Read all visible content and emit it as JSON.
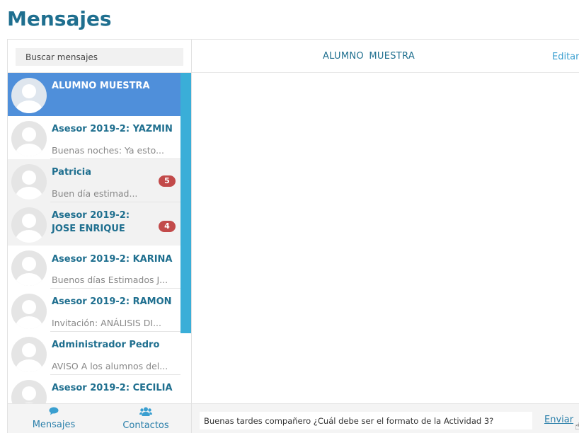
{
  "page": {
    "title": "Mensajes"
  },
  "search": {
    "placeholder": "Buscar mensajes"
  },
  "conversations": [
    {
      "name": "ALUMNO MUESTRA",
      "preview": "",
      "badge": "",
      "selected": true
    },
    {
      "name": "Asesor 2019-2: YAZMIN",
      "preview": "Buenas noches: Ya esto...",
      "badge": ""
    },
    {
      "name": "Patricia",
      "preview": "Buen día estimad...",
      "badge": "5"
    },
    {
      "name": "Asesor 2019-2: JOSE ENRIQUE",
      "preview": "",
      "badge": "4"
    },
    {
      "name": "Asesor 2019-2: KARINA",
      "preview": "Buenos días Estimados J...",
      "badge": ""
    },
    {
      "name": "Asesor 2019-2: RAMON",
      "preview": "Invitación: ANÁLISIS DI...",
      "badge": ""
    },
    {
      "name": "Administrador Pedro",
      "preview": "AVISO A los alumnos del...",
      "badge": ""
    },
    {
      "name": "Asesor 2019-2: CECILIA",
      "preview": "",
      "badge": ""
    }
  ],
  "nav": {
    "messages_label": "Mensajes",
    "contacts_label": "Contactos",
    "messages_icon": "comment-icon",
    "contacts_icon": "users-icon"
  },
  "conversation": {
    "title": "ALUMNO  MUESTRA",
    "edit_label": "Editar",
    "draft_message": "Buenas tardes compañero ¿Cuál debe ser el formato de la Actividad 3?",
    "send_label": "Enviar"
  },
  "colors": {
    "accent": "#1f6f8f",
    "selected": "#4f8fda",
    "scrollbar": "#3aaed8",
    "badge": "#c24a4a"
  }
}
